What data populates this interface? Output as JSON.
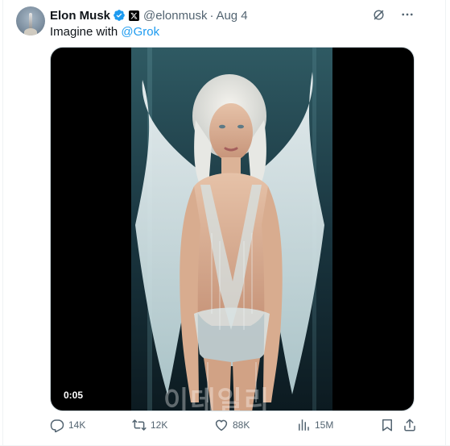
{
  "author": {
    "name": "Elon Musk",
    "handle": "@elonmusk",
    "separator": "·",
    "time": "Aug 4"
  },
  "tweet": {
    "text": "Imagine with ",
    "mention": "@Grok"
  },
  "media": {
    "type": "video",
    "timestamp": "0:05",
    "description_icon": "video-player",
    "watermark": "이데일리"
  },
  "stats": {
    "replies": "14K",
    "reposts": "12K",
    "likes": "88K",
    "views": "15M"
  },
  "icons": {
    "verified": "verified-badge-icon",
    "affiliate": "x-logo-icon",
    "grok": "grok-icon",
    "more": "more-icon",
    "reply": "reply-icon",
    "repost": "repost-icon",
    "like": "heart-icon",
    "views": "views-icon",
    "bookmark": "bookmark-icon",
    "share": "share-icon"
  },
  "colors": {
    "text": "#0f1419",
    "secondary": "#536471",
    "accent": "#1d9bf0",
    "border": "#cfd9de"
  }
}
